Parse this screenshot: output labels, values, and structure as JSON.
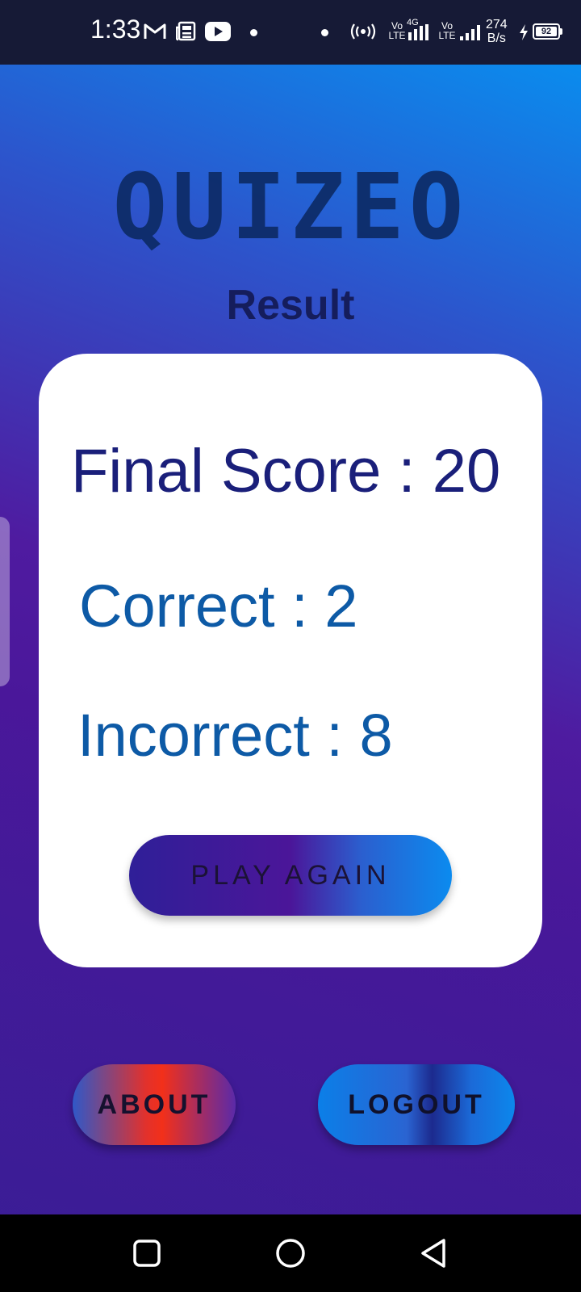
{
  "status_bar": {
    "time": "1:33",
    "network_left": "Vo\nLTE",
    "network_left_badge": "4G",
    "network_right": "Vo\nLTE",
    "speed_value": "274",
    "speed_unit": "B/s",
    "battery": "92",
    "icons": [
      "gmail-icon",
      "news-icon",
      "youtube-icon",
      "hotspot-icon",
      "signal-icon",
      "charging-icon",
      "battery-icon"
    ]
  },
  "app": {
    "logo": "QUIZEO",
    "title": "Result",
    "final_score_label": "Final Score : 20",
    "correct_label": "Correct : 2",
    "incorrect_label": "Incorrect : 8",
    "play_again_label": "PLAY AGAIN",
    "about_label": "ABOUT",
    "logout_label": "LOGOUT"
  },
  "nav_bar": {
    "icons": [
      "recent-apps-icon",
      "home-icon",
      "back-icon"
    ]
  },
  "colors": {
    "status_bar_bg": "#161a36",
    "gradient_top": "#0a8cee",
    "gradient_mid": "#4f1ba0",
    "gradient_bottom": "#3c1e96",
    "card_bg": "#ffffff",
    "final_score_text": "#1a1f7a",
    "count_text": "#0d5aa6",
    "title_text": "#151d5c"
  }
}
